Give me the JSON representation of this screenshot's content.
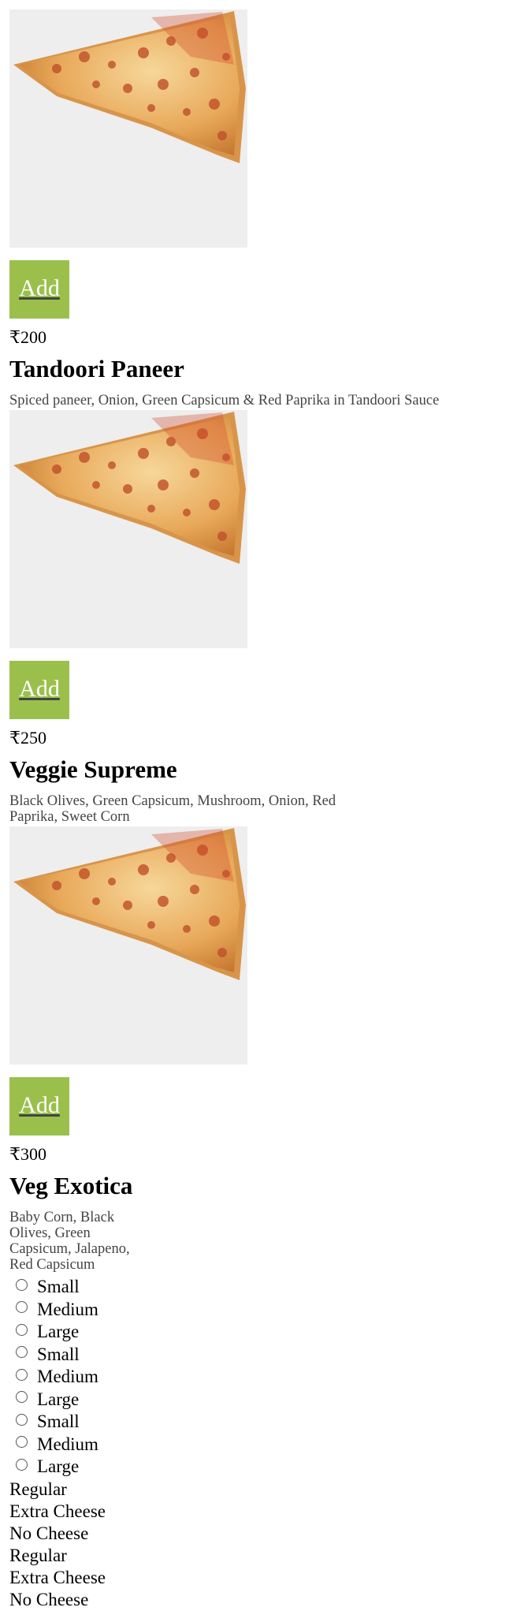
{
  "items": [
    {
      "add_label": "Add",
      "price": "₹200",
      "name": "Tandoori Paneer",
      "description": "Spiced paneer, Onion, Green Capsicum & Red Paprika in Tandoori Sauce"
    },
    {
      "add_label": "Add",
      "price": "₹250",
      "name": "Veggie Supreme",
      "description": "Black Olives, Green Capsicum, Mushroom, Onion, Red Paprika, Sweet Corn"
    },
    {
      "add_label": "Add",
      "price": "₹300",
      "name": "Veg Exotica",
      "description": "Baby Corn, Black Olives, Green Capsicum, Jalapeno, Red Capsicum"
    }
  ],
  "sizes": [
    "Small",
    "Medium",
    "Large",
    "Small",
    "Medium",
    "Large",
    "Small",
    "Medium",
    "Large"
  ],
  "crust_options": [
    "Regular",
    "Extra Cheese",
    "No Cheese",
    "Regular",
    "Extra Cheese",
    "No Cheese"
  ],
  "colors": {
    "add_button": "#9ac04b",
    "image_background": "#eeeeee"
  }
}
